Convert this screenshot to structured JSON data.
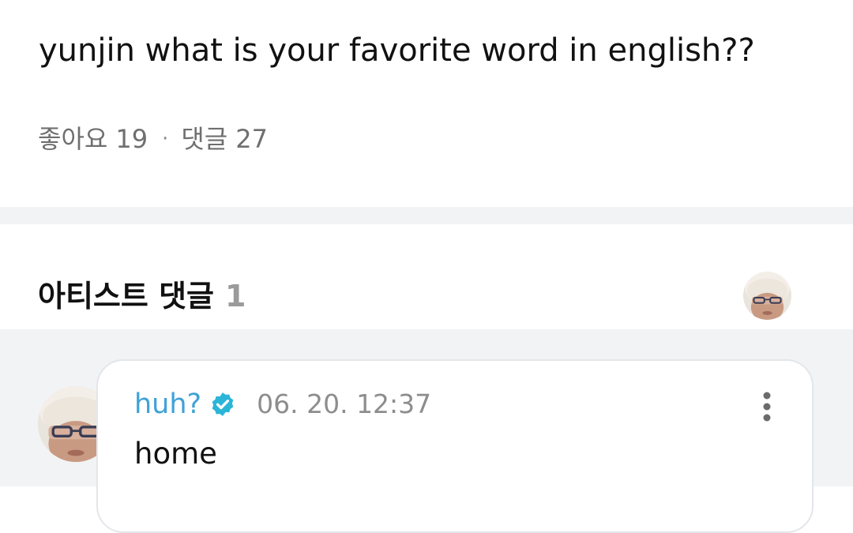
{
  "post": {
    "text": "yunjin what is your favorite word in english??",
    "likes_label": "좋아요",
    "likes_count": "19",
    "separator": "·",
    "comments_label": "댓글",
    "comments_count": "27"
  },
  "artist_comments": {
    "title": "아티스트 댓글",
    "count": "1"
  },
  "comments": [
    {
      "author": "huh?",
      "verified": true,
      "timestamp": "06. 20. 12:37",
      "body": "home"
    }
  ],
  "icons": {
    "verified": "verified-badge-icon",
    "more": "more-vertical-icon"
  },
  "colors": {
    "author": "#3fa2d6",
    "verified_badge": "#2bb5d8",
    "muted_text": "#6f6f6f",
    "band_background": "#f2f3f5"
  }
}
